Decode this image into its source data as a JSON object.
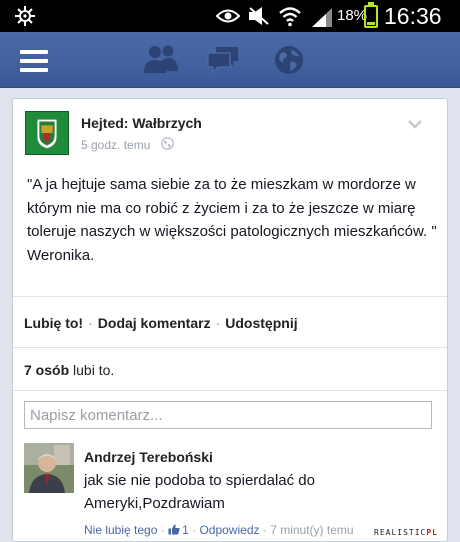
{
  "status_bar": {
    "battery_percent": "18%",
    "battery_level": 0.18,
    "time": "16:36",
    "icons": [
      "app-wheel-icon",
      "eye-icon",
      "mute-icon",
      "wifi-icon",
      "signal-icon",
      "battery-icon"
    ]
  },
  "navbar": {
    "icons": [
      "menu-icon",
      "friend-requests-icon",
      "messages-icon",
      "notifications-globe-icon"
    ],
    "color": "#3b5998"
  },
  "post": {
    "page_name": "Hejted: Wałbrzych",
    "time": "5 godz. temu",
    "text": "\"A ja hejtuje sama siebie za to że mieszkam w mordorze w którym nie ma co robić z życiem i za to że jeszcze w miarę toleruje naszych w większości patologicznych mieszkańców. \" Weronika."
  },
  "actions": {
    "like": "Lubię to!",
    "comment": "Dodaj komentarz",
    "share": "Udostępnij",
    "separator": "·"
  },
  "likes": {
    "count": "7 osób",
    "suffix": "lubi to."
  },
  "comment_box": {
    "placeholder": "Napisz komentarz..."
  },
  "comment": {
    "author": "Andrzej Tereboński",
    "text": "jak sie nie podoba to spierdalać do Ameryki,Pozdrawiam",
    "unlike": "Nie lubię tego",
    "like_count": "1",
    "reply": "Odpowiedz",
    "time": "7 minut(y) temu",
    "separator": "·"
  },
  "watermark": {
    "text": "REALISTIC",
    "suffix": "PL"
  }
}
